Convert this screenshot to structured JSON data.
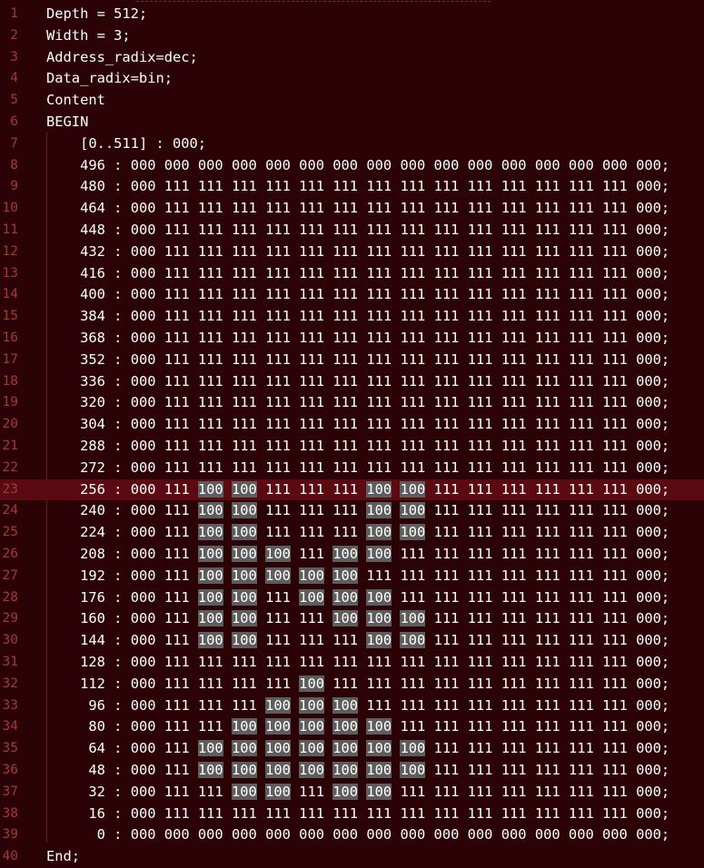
{
  "editor": {
    "header": [
      "Depth = 512;",
      "Width = 3;",
      "Address_radix=dec;",
      "Data_radix=bin;",
      "Content",
      "BEGIN"
    ],
    "default_line": "[0..511] : 000;",
    "rows": [
      {
        "addr": "496",
        "cells": [
          "000",
          "000",
          "000",
          "000",
          "000",
          "000",
          "000",
          "000",
          "000",
          "000",
          "000",
          "000",
          "000",
          "000",
          "000",
          "000"
        ]
      },
      {
        "addr": "480",
        "cells": [
          "000",
          "111",
          "111",
          "111",
          "111",
          "111",
          "111",
          "111",
          "111",
          "111",
          "111",
          "111",
          "111",
          "111",
          "111",
          "000"
        ]
      },
      {
        "addr": "464",
        "cells": [
          "000",
          "111",
          "111",
          "111",
          "111",
          "111",
          "111",
          "111",
          "111",
          "111",
          "111",
          "111",
          "111",
          "111",
          "111",
          "000"
        ]
      },
      {
        "addr": "448",
        "cells": [
          "000",
          "111",
          "111",
          "111",
          "111",
          "111",
          "111",
          "111",
          "111",
          "111",
          "111",
          "111",
          "111",
          "111",
          "111",
          "000"
        ]
      },
      {
        "addr": "432",
        "cells": [
          "000",
          "111",
          "111",
          "111",
          "111",
          "111",
          "111",
          "111",
          "111",
          "111",
          "111",
          "111",
          "111",
          "111",
          "111",
          "000"
        ]
      },
      {
        "addr": "416",
        "cells": [
          "000",
          "111",
          "111",
          "111",
          "111",
          "111",
          "111",
          "111",
          "111",
          "111",
          "111",
          "111",
          "111",
          "111",
          "111",
          "000"
        ]
      },
      {
        "addr": "400",
        "cells": [
          "000",
          "111",
          "111",
          "111",
          "111",
          "111",
          "111",
          "111",
          "111",
          "111",
          "111",
          "111",
          "111",
          "111",
          "111",
          "000"
        ]
      },
      {
        "addr": "384",
        "cells": [
          "000",
          "111",
          "111",
          "111",
          "111",
          "111",
          "111",
          "111",
          "111",
          "111",
          "111",
          "111",
          "111",
          "111",
          "111",
          "000"
        ]
      },
      {
        "addr": "368",
        "cells": [
          "000",
          "111",
          "111",
          "111",
          "111",
          "111",
          "111",
          "111",
          "111",
          "111",
          "111",
          "111",
          "111",
          "111",
          "111",
          "000"
        ]
      },
      {
        "addr": "352",
        "cells": [
          "000",
          "111",
          "111",
          "111",
          "111",
          "111",
          "111",
          "111",
          "111",
          "111",
          "111",
          "111",
          "111",
          "111",
          "111",
          "000"
        ]
      },
      {
        "addr": "336",
        "cells": [
          "000",
          "111",
          "111",
          "111",
          "111",
          "111",
          "111",
          "111",
          "111",
          "111",
          "111",
          "111",
          "111",
          "111",
          "111",
          "000"
        ]
      },
      {
        "addr": "320",
        "cells": [
          "000",
          "111",
          "111",
          "111",
          "111",
          "111",
          "111",
          "111",
          "111",
          "111",
          "111",
          "111",
          "111",
          "111",
          "111",
          "000"
        ]
      },
      {
        "addr": "304",
        "cells": [
          "000",
          "111",
          "111",
          "111",
          "111",
          "111",
          "111",
          "111",
          "111",
          "111",
          "111",
          "111",
          "111",
          "111",
          "111",
          "000"
        ]
      },
      {
        "addr": "288",
        "cells": [
          "000",
          "111",
          "111",
          "111",
          "111",
          "111",
          "111",
          "111",
          "111",
          "111",
          "111",
          "111",
          "111",
          "111",
          "111",
          "000"
        ]
      },
      {
        "addr": "272",
        "cells": [
          "000",
          "111",
          "111",
          "111",
          "111",
          "111",
          "111",
          "111",
          "111",
          "111",
          "111",
          "111",
          "111",
          "111",
          "111",
          "000"
        ]
      },
      {
        "addr": "256",
        "cells": [
          "000",
          "111",
          "100",
          "100",
          "111",
          "111",
          "111",
          "100",
          "100",
          "111",
          "111",
          "111",
          "111",
          "111",
          "111",
          "000"
        ]
      },
      {
        "addr": "240",
        "cells": [
          "000",
          "111",
          "100",
          "100",
          "111",
          "111",
          "111",
          "100",
          "100",
          "111",
          "111",
          "111",
          "111",
          "111",
          "111",
          "000"
        ]
      },
      {
        "addr": "224",
        "cells": [
          "000",
          "111",
          "100",
          "100",
          "111",
          "111",
          "111",
          "100",
          "100",
          "111",
          "111",
          "111",
          "111",
          "111",
          "111",
          "000"
        ]
      },
      {
        "addr": "208",
        "cells": [
          "000",
          "111",
          "100",
          "100",
          "100",
          "111",
          "100",
          "100",
          "111",
          "111",
          "111",
          "111",
          "111",
          "111",
          "111",
          "000"
        ]
      },
      {
        "addr": "192",
        "cells": [
          "000",
          "111",
          "100",
          "100",
          "100",
          "100",
          "100",
          "111",
          "111",
          "111",
          "111",
          "111",
          "111",
          "111",
          "111",
          "000"
        ]
      },
      {
        "addr": "176",
        "cells": [
          "000",
          "111",
          "100",
          "100",
          "111",
          "100",
          "100",
          "100",
          "111",
          "111",
          "111",
          "111",
          "111",
          "111",
          "111",
          "000"
        ]
      },
      {
        "addr": "160",
        "cells": [
          "000",
          "111",
          "100",
          "100",
          "111",
          "111",
          "100",
          "100",
          "100",
          "111",
          "111",
          "111",
          "111",
          "111",
          "111",
          "000"
        ]
      },
      {
        "addr": "144",
        "cells": [
          "000",
          "111",
          "100",
          "100",
          "111",
          "111",
          "111",
          "100",
          "100",
          "111",
          "111",
          "111",
          "111",
          "111",
          "111",
          "000"
        ]
      },
      {
        "addr": "128",
        "cells": [
          "000",
          "111",
          "111",
          "111",
          "111",
          "111",
          "111",
          "111",
          "111",
          "111",
          "111",
          "111",
          "111",
          "111",
          "111",
          "000"
        ]
      },
      {
        "addr": "112",
        "cells": [
          "000",
          "111",
          "111",
          "111",
          "111",
          "100",
          "111",
          "111",
          "111",
          "111",
          "111",
          "111",
          "111",
          "111",
          "111",
          "000"
        ]
      },
      {
        "addr": "96",
        "cells": [
          "000",
          "111",
          "111",
          "111",
          "100",
          "100",
          "100",
          "111",
          "111",
          "111",
          "111",
          "111",
          "111",
          "111",
          "111",
          "000"
        ]
      },
      {
        "addr": "80",
        "cells": [
          "000",
          "111",
          "111",
          "100",
          "100",
          "100",
          "100",
          "100",
          "111",
          "111",
          "111",
          "111",
          "111",
          "111",
          "111",
          "000"
        ]
      },
      {
        "addr": "64",
        "cells": [
          "000",
          "111",
          "100",
          "100",
          "100",
          "100",
          "100",
          "100",
          "100",
          "111",
          "111",
          "111",
          "111",
          "111",
          "111",
          "000"
        ]
      },
      {
        "addr": "48",
        "cells": [
          "000",
          "111",
          "100",
          "100",
          "100",
          "100",
          "100",
          "100",
          "100",
          "111",
          "111",
          "111",
          "111",
          "111",
          "111",
          "000"
        ]
      },
      {
        "addr": "32",
        "cells": [
          "000",
          "111",
          "111",
          "100",
          "100",
          "111",
          "100",
          "100",
          "111",
          "111",
          "111",
          "111",
          "111",
          "111",
          "111",
          "000"
        ]
      },
      {
        "addr": "16",
        "cells": [
          "000",
          "111",
          "111",
          "111",
          "111",
          "111",
          "111",
          "111",
          "111",
          "111",
          "111",
          "111",
          "111",
          "111",
          "111",
          "000"
        ]
      },
      {
        "addr": "0",
        "cells": [
          "000",
          "000",
          "000",
          "000",
          "000",
          "000",
          "000",
          "000",
          "000",
          "000",
          "000",
          "000",
          "000",
          "000",
          "000",
          "000"
        ]
      }
    ],
    "footer": "End;",
    "line_numbers": [
      "1",
      "2",
      "3",
      "4",
      "5",
      "6",
      "7",
      "8",
      "9",
      "10",
      "11",
      "12",
      "13",
      "14",
      "15",
      "16",
      "17",
      "18",
      "19",
      "20",
      "21",
      "22",
      "23",
      "24",
      "25",
      "26",
      "27",
      "28",
      "29",
      "30",
      "31",
      "32",
      "33",
      "34",
      "35",
      "36",
      "37",
      "38",
      "39",
      "40"
    ],
    "current_line": 23,
    "highlight_value": "100",
    "colors": {
      "background": "#2b0205",
      "current_line": "#5a0a10",
      "gutter_text": "#a13a3a",
      "code_text": "#ffffff",
      "match_highlight": "#5d5d5d"
    }
  }
}
